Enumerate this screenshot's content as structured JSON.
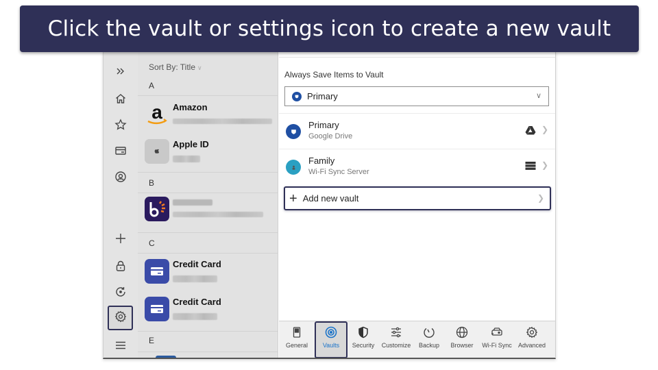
{
  "banner": {
    "text": "Click the vault or settings icon to create a new vault"
  },
  "rail": {
    "items": [
      {
        "name": "expand",
        "icon": "double-chevron-right-icon"
      },
      {
        "name": "home",
        "icon": "home-icon"
      },
      {
        "name": "favorites",
        "icon": "star-icon"
      },
      {
        "name": "cards",
        "icon": "card-icon"
      },
      {
        "name": "identities",
        "icon": "user-circle-icon"
      },
      {
        "name": "add",
        "icon": "plus-icon"
      },
      {
        "name": "lock",
        "icon": "lock-icon"
      },
      {
        "name": "sync",
        "icon": "sync-icon"
      },
      {
        "name": "settings",
        "icon": "gear-icon",
        "active": true
      },
      {
        "name": "menu",
        "icon": "hamburger-icon"
      }
    ]
  },
  "list": {
    "sort_label": "Sort By: Title",
    "sections": [
      {
        "letter": "A",
        "items": [
          {
            "title": "Amazon",
            "logo": "amazon-logo"
          },
          {
            "title": "Apple ID",
            "logo": "apple-logo"
          }
        ]
      },
      {
        "letter": "B",
        "items": [
          {
            "title": "",
            "logo": "b-logo"
          }
        ]
      },
      {
        "letter": "C",
        "items": [
          {
            "title": "Credit Card",
            "logo": "credit-card-icon"
          },
          {
            "title": "Credit Card",
            "logo": "credit-card-icon"
          }
        ]
      },
      {
        "letter": "E",
        "items": []
      }
    ]
  },
  "vaults": {
    "always_save_label": "Always Save Items to Vault",
    "selected_vault": "Primary",
    "rows": [
      {
        "name": "Primary",
        "location": "Google Drive",
        "kind_icon": "google-drive-icon",
        "color": "#1f4fa3"
      },
      {
        "name": "Family",
        "location": "Wi-Fi Sync Server",
        "kind_icon": "server-icon",
        "color": "#2aa0c2"
      }
    ],
    "add_label": "Add new vault"
  },
  "tabs": [
    {
      "label": "General",
      "icon": "switch-icon"
    },
    {
      "label": "Vaults",
      "icon": "vault-icon",
      "active": true
    },
    {
      "label": "Security",
      "icon": "shield-icon"
    },
    {
      "label": "Customize",
      "icon": "sliders-icon"
    },
    {
      "label": "Backup",
      "icon": "backup-icon"
    },
    {
      "label": "Browser",
      "icon": "globe-icon"
    },
    {
      "label": "Wi-Fi Sync",
      "icon": "wifi-sync-icon"
    },
    {
      "label": "Advanced",
      "icon": "gear-icon"
    }
  ],
  "colors": {
    "banner": "#2f3057",
    "accent": "#1a73c9",
    "highlight": "#2f3057"
  }
}
